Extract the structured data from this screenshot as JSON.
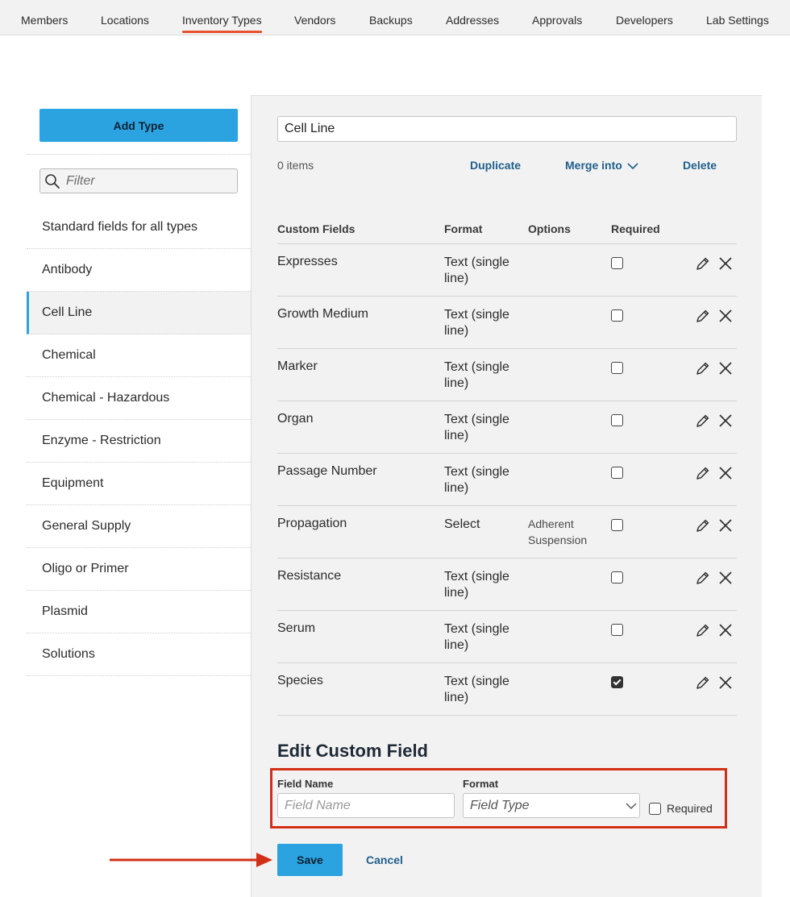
{
  "nav": {
    "tabs": [
      {
        "label": "Members"
      },
      {
        "label": "Locations"
      },
      {
        "label": "Inventory Types"
      },
      {
        "label": "Vendors"
      },
      {
        "label": "Backups"
      },
      {
        "label": "Addresses"
      },
      {
        "label": "Approvals"
      },
      {
        "label": "Developers"
      },
      {
        "label": "Lab Settings"
      }
    ],
    "active_tab": "Inventory Types",
    "active_color": "#e8532c"
  },
  "sidebar": {
    "add_button": "Add Type",
    "filter_placeholder": "Filter",
    "items": [
      {
        "label": "Standard fields for all types"
      },
      {
        "label": "Antibody"
      },
      {
        "label": "Cell Line"
      },
      {
        "label": "Chemical"
      },
      {
        "label": "Chemical - Hazardous"
      },
      {
        "label": "Enzyme - Restriction"
      },
      {
        "label": "Equipment"
      },
      {
        "label": "General Supply"
      },
      {
        "label": "Oligo or Primer"
      },
      {
        "label": "Plasmid"
      },
      {
        "label": "Solutions"
      }
    ],
    "selected": "Cell Line"
  },
  "type_detail": {
    "name_value": "Cell Line",
    "item_count": "0 items",
    "duplicate": "Duplicate",
    "merge_into": "Merge into",
    "delete": "Delete",
    "columns": {
      "field": "Custom Fields",
      "format": "Format",
      "options": "Options",
      "required": "Required"
    },
    "fields": [
      {
        "name": "Expresses",
        "format": "Text (single line)",
        "options": "",
        "required": false
      },
      {
        "name": "Growth Medium",
        "format": "Text (single line)",
        "options": "",
        "required": false
      },
      {
        "name": "Marker",
        "format": "Text (single line)",
        "options": "",
        "required": false
      },
      {
        "name": "Organ",
        "format": "Text (single line)",
        "options": "",
        "required": false
      },
      {
        "name": "Passage Number",
        "format": "Text (single line)",
        "options": "",
        "required": false
      },
      {
        "name": "Propagation",
        "format": "Select",
        "options": "Adherent Suspension",
        "required": false
      },
      {
        "name": "Resistance",
        "format": "Text (single line)",
        "options": "",
        "required": false
      },
      {
        "name": "Serum",
        "format": "Text (single line)",
        "options": "",
        "required": false
      },
      {
        "name": "Species",
        "format": "Text (single line)",
        "options": "",
        "required": true
      }
    ]
  },
  "edit_field": {
    "title": "Edit Custom Field",
    "field_name_label": "Field Name",
    "field_name_placeholder": "Field Name",
    "format_label": "Format",
    "format_placeholder": "Field Type",
    "required_label": "Required",
    "required": false,
    "save": "Save",
    "cancel": "Cancel",
    "highlight_color": "#d32f16"
  },
  "colors": {
    "primary_button": "#2aa3e0",
    "link": "#1f5f8b",
    "annotation_arrow": "#d32f16"
  },
  "icons": [
    "search-icon",
    "chevron-down-icon",
    "pencil-icon",
    "close-icon",
    "arrow-right-icon"
  ]
}
